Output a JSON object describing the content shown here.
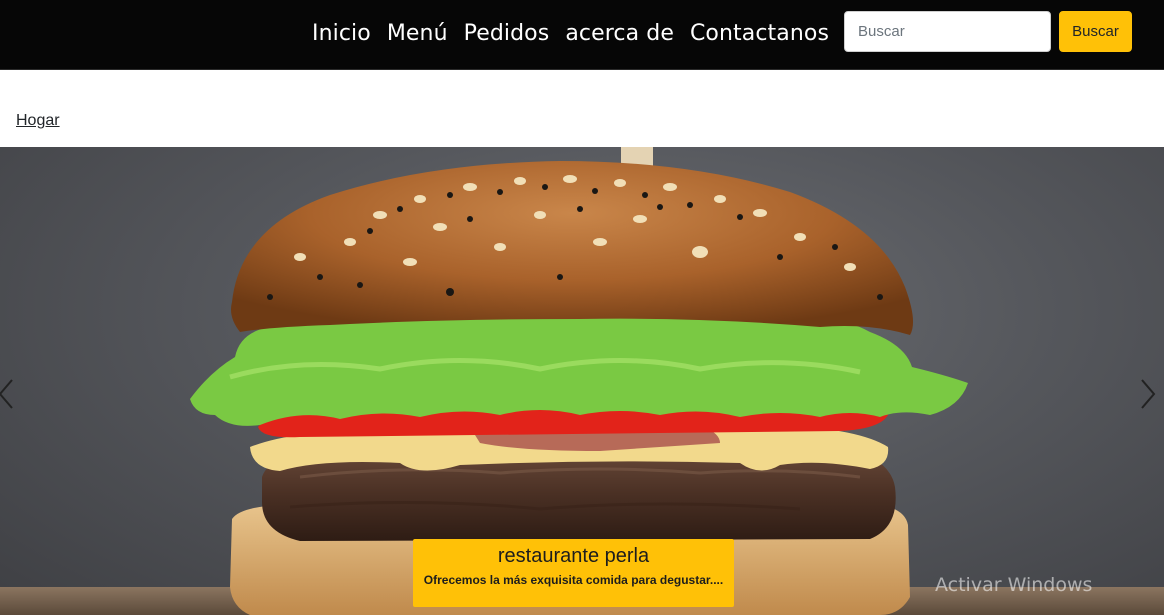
{
  "nav": {
    "links": [
      "Inicio",
      "Menú",
      "Pedidos",
      "acerca de",
      "Contactanos"
    ]
  },
  "search": {
    "placeholder": "Buscar",
    "button_label": "Buscar"
  },
  "breadcrumb": {
    "label": "Hogar"
  },
  "carousel": {
    "caption_title": "restaurante perla",
    "caption_text": "Ofrecemos la más exquisita comida para degustar...."
  },
  "watermark": "Activar Windows",
  "colors": {
    "navbar_bg": "#060606",
    "accent": "#ffc107"
  },
  "icons": {
    "prev": "chevron-left-icon",
    "next": "chevron-right-icon"
  }
}
